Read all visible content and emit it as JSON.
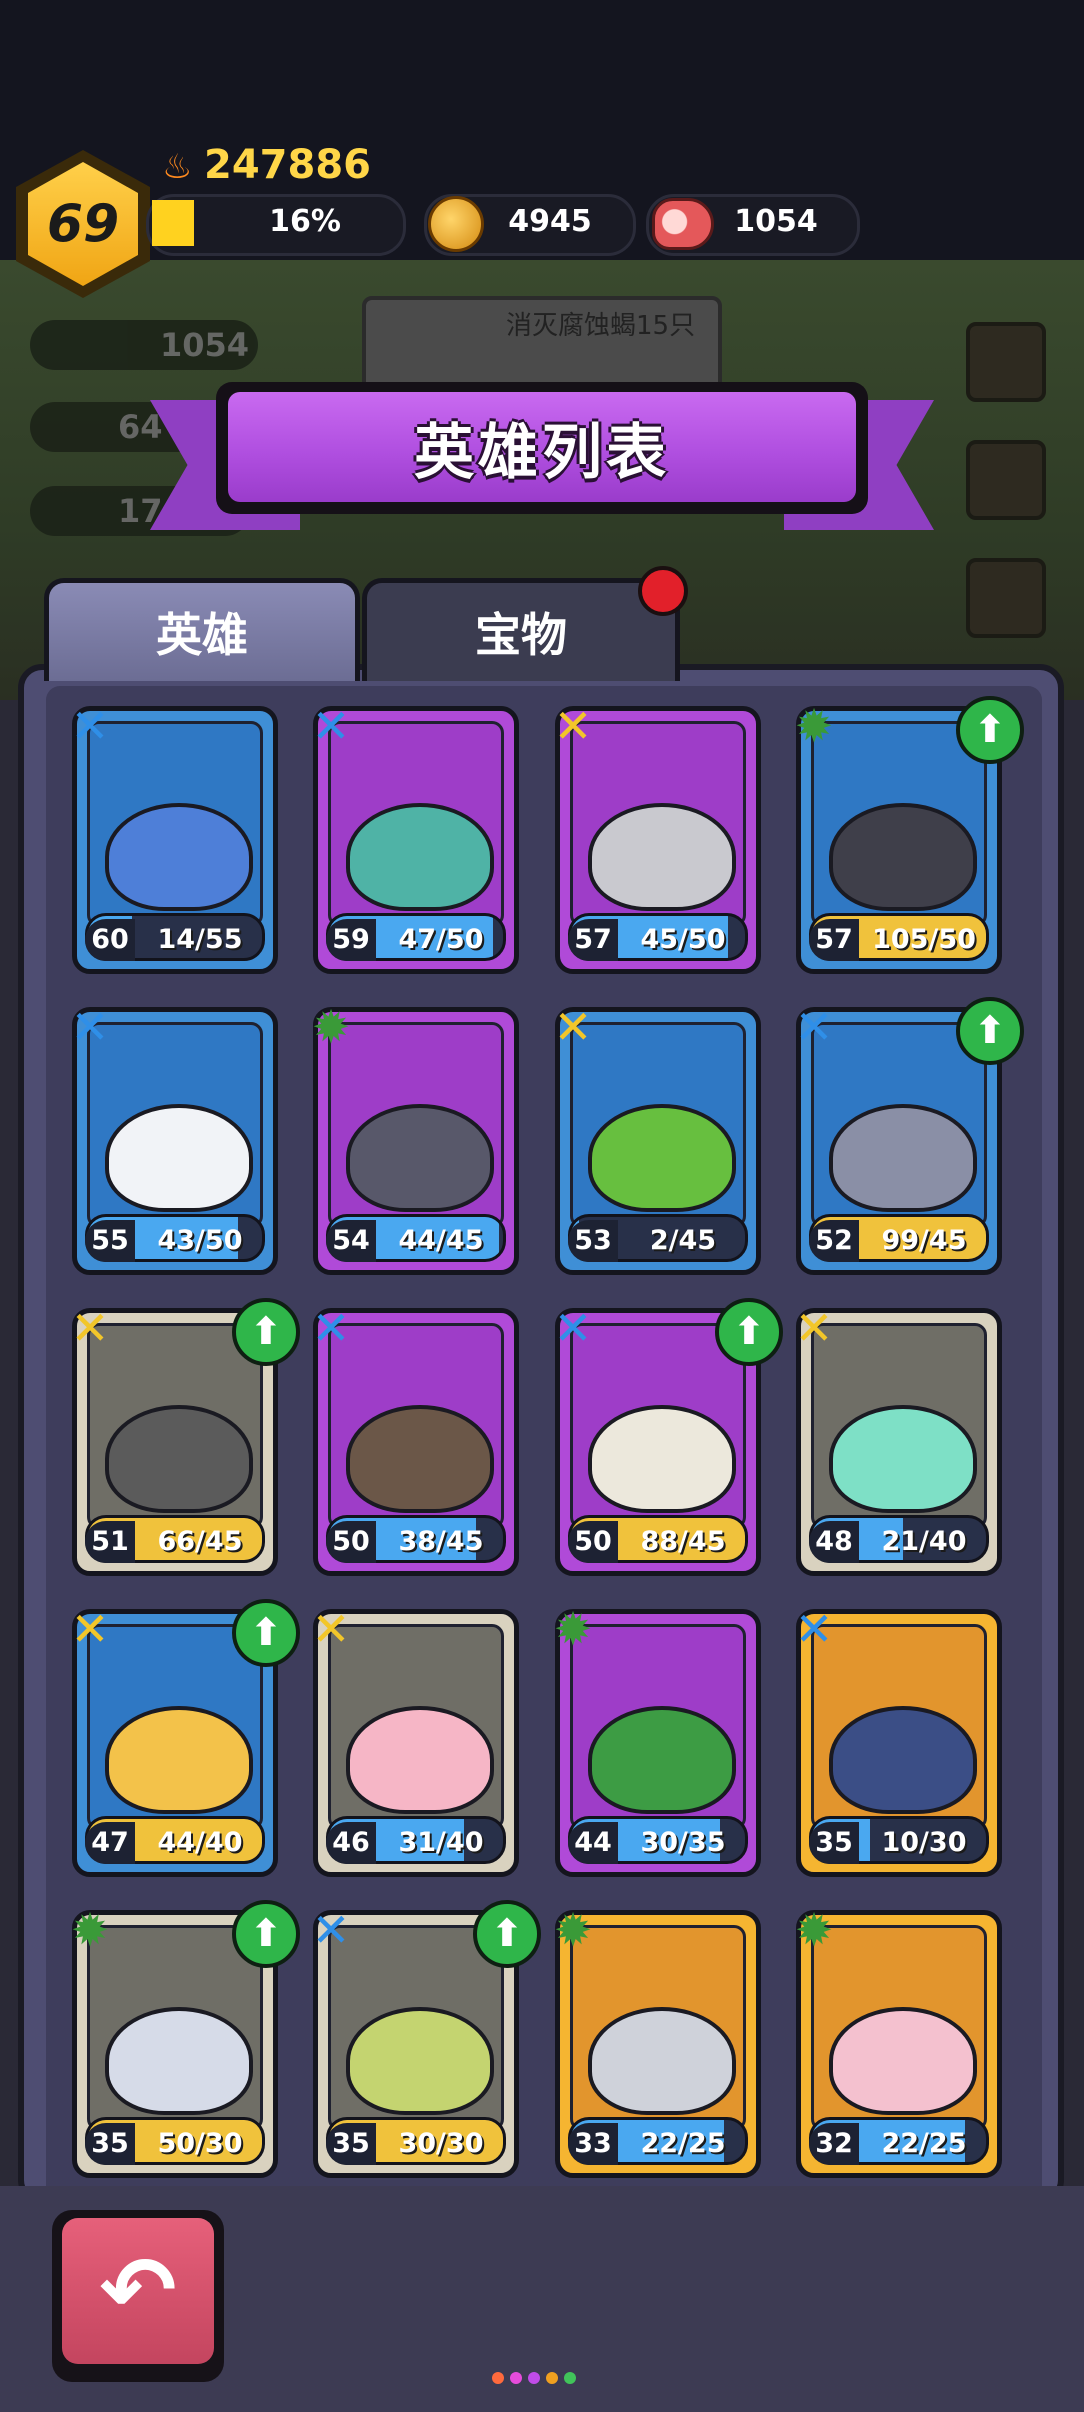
{
  "hud": {
    "level": "69",
    "power": "247886",
    "exp_percent_label": "16%",
    "gold": "4945",
    "meat": "1054"
  },
  "background": {
    "meat_count": "1054",
    "wood_count": "64",
    "ore_count": "17",
    "quest_text": "消灭腐蚀蝎15只"
  },
  "popup": {
    "title": "英雄列表",
    "tabs": [
      {
        "label": "英雄",
        "active": true
      },
      {
        "label": "宝物",
        "active": false,
        "has_notification": true
      }
    ]
  },
  "heroes": [
    {
      "level": "60",
      "shards": "14/55",
      "card_color": "blue",
      "rarity": "blue",
      "upgrade": false,
      "blob": "#4e7fd8"
    },
    {
      "level": "59",
      "shards": "47/50",
      "card_color": "purple",
      "rarity": "blue",
      "upgrade": false,
      "blob": "#4fb3a6"
    },
    {
      "level": "57",
      "shards": "45/50",
      "card_color": "purple",
      "rarity": "gold",
      "upgrade": false,
      "blob": "#c9c9cf"
    },
    {
      "level": "57",
      "shards": "105/50",
      "card_color": "blue",
      "rarity": "green",
      "upgrade": true,
      "blob": "#3f3f4a"
    },
    {
      "level": "55",
      "shards": "43/50",
      "card_color": "blue",
      "rarity": "blue",
      "upgrade": false,
      "blob": "#f1f3f7"
    },
    {
      "level": "54",
      "shards": "44/45",
      "card_color": "purple",
      "rarity": "green",
      "upgrade": false,
      "blob": "#58586a"
    },
    {
      "level": "53",
      "shards": "2/45",
      "card_color": "blue",
      "rarity": "gold",
      "upgrade": false,
      "blob": "#67bf3f"
    },
    {
      "level": "52",
      "shards": "99/45",
      "card_color": "blue",
      "rarity": "blue",
      "upgrade": true,
      "blob": "#8a8fa6"
    },
    {
      "level": "51",
      "shards": "66/45",
      "card_color": "gray",
      "rarity": "gold",
      "upgrade": true,
      "blob": "#5b5b5b"
    },
    {
      "level": "50",
      "shards": "38/45",
      "card_color": "purple",
      "rarity": "blue",
      "upgrade": false,
      "blob": "#6b5748"
    },
    {
      "level": "50",
      "shards": "88/45",
      "card_color": "purple",
      "rarity": "blue",
      "upgrade": true,
      "blob": "#ece8dc"
    },
    {
      "level": "48",
      "shards": "21/40",
      "card_color": "gray",
      "rarity": "gold",
      "upgrade": false,
      "blob": "#7ee0c6"
    },
    {
      "level": "47",
      "shards": "44/40",
      "card_color": "blue",
      "rarity": "gold",
      "upgrade": true,
      "blob": "#f3c24a"
    },
    {
      "level": "46",
      "shards": "31/40",
      "card_color": "gray",
      "rarity": "gold",
      "upgrade": false,
      "blob": "#f6b6c6"
    },
    {
      "level": "44",
      "shards": "30/35",
      "card_color": "purple",
      "rarity": "green",
      "upgrade": false,
      "blob": "#3d9c44"
    },
    {
      "level": "35",
      "shards": "10/30",
      "card_color": "orange",
      "rarity": "blue",
      "upgrade": false,
      "blob": "#3b4e86"
    },
    {
      "level": "35",
      "shards": "50/30",
      "card_color": "gray",
      "rarity": "green",
      "upgrade": true,
      "blob": "#d6dbe8"
    },
    {
      "level": "35",
      "shards": "30/30",
      "card_color": "gray",
      "rarity": "blue",
      "upgrade": true,
      "blob": "#c4d470"
    },
    {
      "level": "33",
      "shards": "22/25",
      "card_color": "orange",
      "rarity": "green",
      "upgrade": false,
      "blob": "#cfd2da"
    },
    {
      "level": "32",
      "shards": "22/25",
      "card_color": "orange",
      "rarity": "green",
      "upgrade": false,
      "blob": "#f4c1cf"
    }
  ],
  "colors": {
    "shard_full": "#f0c23c",
    "shard_partial": "#4aa8f0",
    "rarity_blue": "#2f8fe8",
    "rarity_gold": "#f2c62a",
    "rarity_green": "#3a9a38"
  },
  "footer": {
    "back_icon": "back-arrow-icon",
    "page_dot_colors": [
      "#ff6a3d",
      "#e64cdb",
      "#c04ce8",
      "#f0a020",
      "#41c45a"
    ]
  }
}
